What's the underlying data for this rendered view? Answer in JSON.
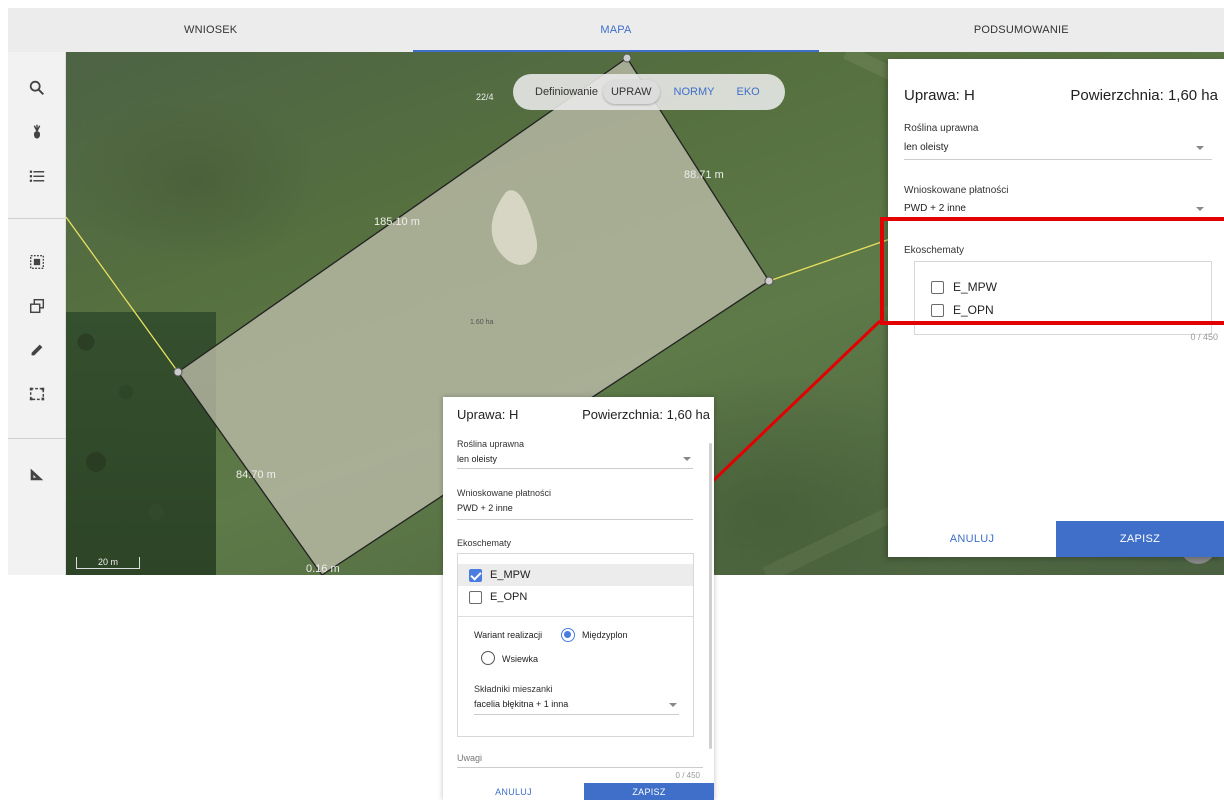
{
  "tabs": [
    {
      "label": "WNIOSEK"
    },
    {
      "label": "MAPA"
    },
    {
      "label": "PODSUMOWANIE"
    }
  ],
  "tabs_active": "MAPA",
  "toolbar": {
    "icons": [
      "search-icon",
      "plant-icon",
      "list-icon",
      "select-area-icon",
      "copy-shape-icon",
      "pencil-icon",
      "dashed-rectangle-icon",
      "measure-icon"
    ]
  },
  "map": {
    "definition_label": "Definiowanie",
    "segments": [
      "UPRAW",
      "NORMY",
      "EKO"
    ],
    "active_segment": "UPRAW",
    "parcel_number": "22/4",
    "measurements": {
      "top": "185.10 m",
      "right": "88.71 m",
      "left": "84.70 m",
      "bottom": "0.16 m",
      "area": "1.60 ha"
    },
    "scale": "20 m"
  },
  "panel": {
    "title": "Uprawa: H",
    "area": "Powierzchnia: 1,60 ha",
    "crop_label": "Roślina uprawna",
    "crop_value": "len oleisty",
    "payments_label": "Wnioskowane płatności",
    "payments_value": "PWD + 2 inne",
    "eco_label": "Ekoschematy",
    "eco_options": [
      {
        "label": "E_MPW",
        "checked": false
      },
      {
        "label": "E_OPN",
        "checked": false
      }
    ],
    "counter": "0 / 450",
    "cancel": "ANULUJ",
    "save": "ZAPISZ"
  },
  "zoom_panel": {
    "title": "Uprawa: H",
    "area": "Powierzchnia: 1,60 ha",
    "crop_label": "Roślina uprawna",
    "crop_value": "len oleisty",
    "payments_label": "Wnioskowane płatności",
    "payments_value": "PWD + 2 inne",
    "eco_label": "Ekoschematy",
    "eco_options": [
      {
        "label": "E_MPW",
        "checked": true
      },
      {
        "label": "E_OPN",
        "checked": false
      }
    ],
    "variant_label": "Wariant realizacji",
    "variant_options": [
      {
        "label": "Międzyplon",
        "selected": true
      },
      {
        "label": "Wsiewka",
        "selected": false
      }
    ],
    "mix_label": "Składniki mieszanki",
    "mix_value": "facelia błękitna + 1 inna",
    "notes_label": "Uwagi",
    "counter": "0 / 450",
    "cancel": "ANULUJ",
    "save": "ZAPISZ"
  },
  "colors": {
    "accent": "#3f6fc8",
    "highlight": "#e30000",
    "checkbox_checked": "#4a7de0"
  }
}
